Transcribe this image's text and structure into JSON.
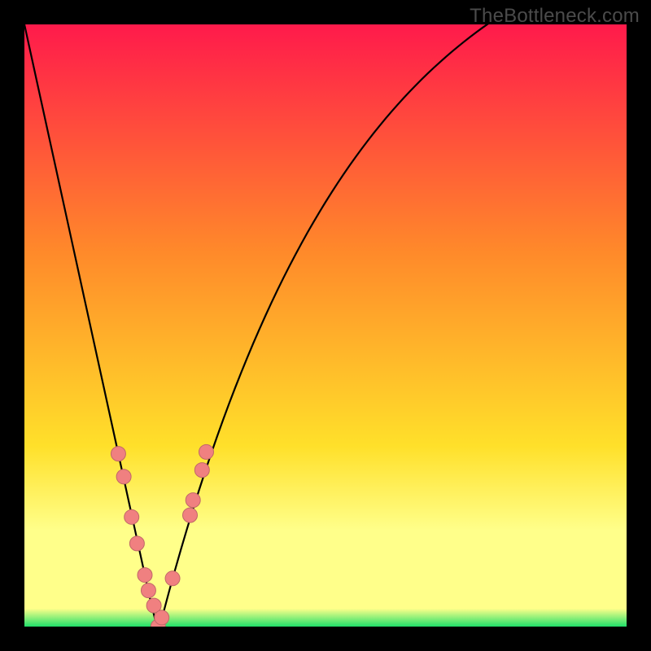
{
  "watermark": "TheBottleneck.com",
  "colors": {
    "grad_top": "#ff1a4b",
    "grad_mid_orange": "#ff8a2a",
    "grad_yellow": "#ffe02a",
    "grad_lightyellow": "#ffff8a",
    "grad_green": "#20e06a",
    "curve": "#000000",
    "marker_fill": "#f08080",
    "marker_stroke": "#c06868",
    "frame": "#000000"
  },
  "chart_data": {
    "type": "line",
    "title": "",
    "xlabel": "",
    "ylabel": "",
    "xlim": [
      0,
      100
    ],
    "ylim": [
      0,
      100
    ],
    "x": [
      0,
      1,
      2,
      3,
      4,
      5,
      6,
      7,
      8,
      9,
      10,
      11,
      12,
      13,
      14,
      15,
      16,
      17,
      18,
      19,
      20,
      21,
      22,
      23,
      24,
      25,
      26,
      27,
      28,
      29,
      30,
      31,
      32,
      33,
      34,
      35,
      36,
      37,
      38,
      39,
      40,
      41,
      42,
      43,
      44,
      45,
      46,
      47,
      48,
      49,
      50,
      51,
      52,
      53,
      54,
      55,
      56,
      57,
      58,
      59,
      60,
      61,
      62,
      63,
      64,
      65,
      66,
      67,
      68,
      69,
      70,
      71,
      72,
      73,
      74,
      75,
      76,
      77,
      78,
      79,
      80,
      81,
      82,
      83,
      84,
      85,
      86,
      87,
      88,
      89,
      90,
      91,
      92,
      93,
      94,
      95,
      96,
      97,
      98,
      99,
      100
    ],
    "values": [
      100.0,
      95.42,
      90.85,
      86.28,
      81.71,
      77.14,
      72.57,
      68.0,
      63.42,
      58.85,
      54.28,
      49.71,
      45.14,
      40.57,
      36.0,
      31.43,
      26.86,
      22.28,
      17.71,
      13.14,
      8.57,
      4.0,
      0.0,
      2.0,
      5.74,
      9.36,
      12.85,
      16.23,
      19.5,
      22.67,
      25.73,
      28.7,
      31.57,
      34.36,
      37.06,
      39.67,
      42.2,
      44.65,
      47.03,
      49.34,
      51.57,
      53.74,
      55.84,
      57.88,
      59.85,
      61.76,
      63.62,
      65.42,
      67.16,
      68.85,
      70.49,
      72.08,
      73.62,
      75.12,
      76.57,
      77.98,
      79.34,
      80.66,
      81.95,
      83.19,
      84.4,
      85.57,
      86.7,
      87.8,
      88.87,
      89.9,
      90.91,
      91.88,
      92.82,
      93.73,
      94.62,
      95.48,
      96.31,
      97.12,
      97.9,
      98.66,
      99.4,
      100.11,
      100.8,
      101.48,
      102.13,
      102.76,
      103.37,
      103.96,
      104.54,
      105.1,
      105.64,
      106.17,
      106.68,
      107.17,
      107.65,
      108.12,
      108.57,
      109.01,
      109.44,
      109.85,
      110.26,
      110.65,
      111.03,
      111.4,
      111.76
    ],
    "markers_x": [
      15.6,
      16.5,
      17.8,
      18.7,
      20.0,
      20.6,
      21.5,
      22.2,
      22.8,
      24.6,
      27.5,
      28.0,
      29.5,
      30.2
    ],
    "markers_y": [
      28.7,
      24.9,
      18.2,
      13.8,
      8.57,
      6.0,
      3.5,
      0.0,
      1.5,
      8.0,
      18.5,
      21.0,
      26.0,
      29.0
    ],
    "gradient_stops": [
      {
        "offset": 0.0,
        "key": "grad_top"
      },
      {
        "offset": 0.38,
        "key": "grad_mid_orange"
      },
      {
        "offset": 0.7,
        "key": "grad_yellow"
      },
      {
        "offset": 0.84,
        "key": "grad_lightyellow"
      },
      {
        "offset": 0.97,
        "key": "grad_lightyellow"
      },
      {
        "offset": 1.0,
        "key": "grad_green"
      }
    ]
  }
}
